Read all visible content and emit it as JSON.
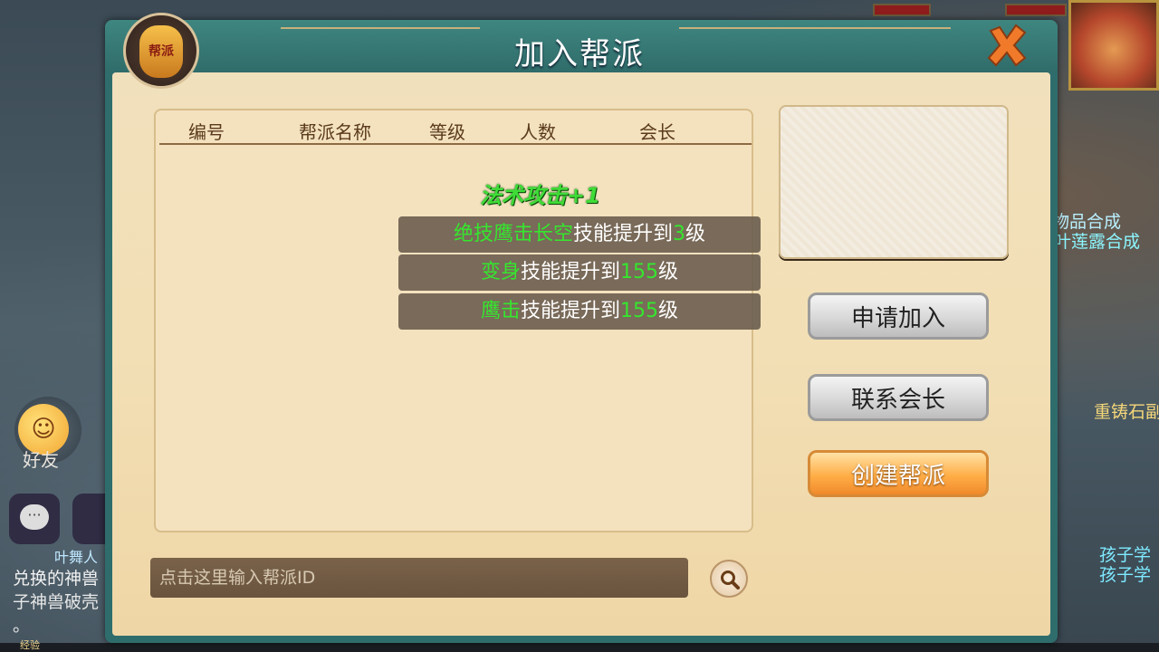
{
  "dialog": {
    "title": "加入帮派",
    "badge_text": "帮派"
  },
  "list": {
    "columns": [
      "编号",
      "帮派名称",
      "等级",
      "人数",
      "会长"
    ]
  },
  "buff": {
    "title": "法术攻击+1",
    "skills": [
      {
        "name": "绝技鹰击长空",
        "text": "技能提升到",
        "level": "3",
        "unit": "级"
      },
      {
        "name": "变身",
        "text": "技能提升到",
        "level": "155",
        "unit": "级"
      },
      {
        "name": "鹰击",
        "text": "技能提升到",
        "level": "155",
        "unit": "级"
      }
    ]
  },
  "buttons": {
    "apply": "申请加入",
    "contact": "联系会长",
    "create": "创建帮派"
  },
  "search": {
    "placeholder": "点击这里输入帮派ID"
  },
  "background": {
    "friend_label": "好友",
    "chat_lines": [
      "兑换的神兽",
      "子神兽破壳",
      "。"
    ],
    "chat_name": "叶舞人",
    "right_texts": [
      "物品合成",
      "叶莲露合成",
      "重铸石副",
      "孩子学",
      "孩子学"
    ],
    "exp_label": "经验"
  },
  "colors": {
    "highlight_green": "#35e62e",
    "header_teal": "#2f6d6d",
    "create_orange": "#f08a2a"
  }
}
